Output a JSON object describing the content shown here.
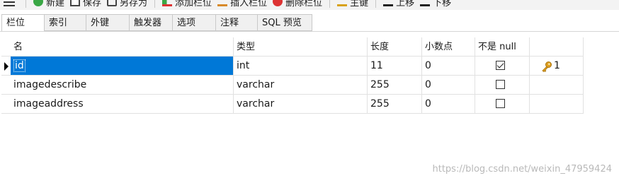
{
  "toolbar": {
    "new_label": "新建",
    "save_label": "保存",
    "saveas_label": "另存为",
    "addcol_label": "添加栏位",
    "inscol_label": "插入栏位",
    "delcol_label": "删除栏位",
    "pk_label": "主键",
    "up_label": "上移",
    "down_label": "下移"
  },
  "tabs": [
    "栏位",
    "索引",
    "外键",
    "触发器",
    "选项",
    "注释",
    "SQL 预览"
  ],
  "grid": {
    "columns": [
      "名",
      "类型",
      "长度",
      "小数点",
      "不是 null",
      ""
    ],
    "rows": [
      {
        "name": "id",
        "type": "int",
        "length": "11",
        "decimals": "0",
        "not_null": true,
        "key": "1"
      },
      {
        "name": "imagedescribe",
        "type": "varchar",
        "length": "255",
        "decimals": "0",
        "not_null": false,
        "key": ""
      },
      {
        "name": "imageaddress",
        "type": "varchar",
        "length": "255",
        "decimals": "0",
        "not_null": false,
        "key": ""
      }
    ]
  },
  "watermark": "https://blog.csdn.net/weixin_47959424",
  "colors": {
    "selection": "#0078d7",
    "key_icon": "#e0a020"
  }
}
